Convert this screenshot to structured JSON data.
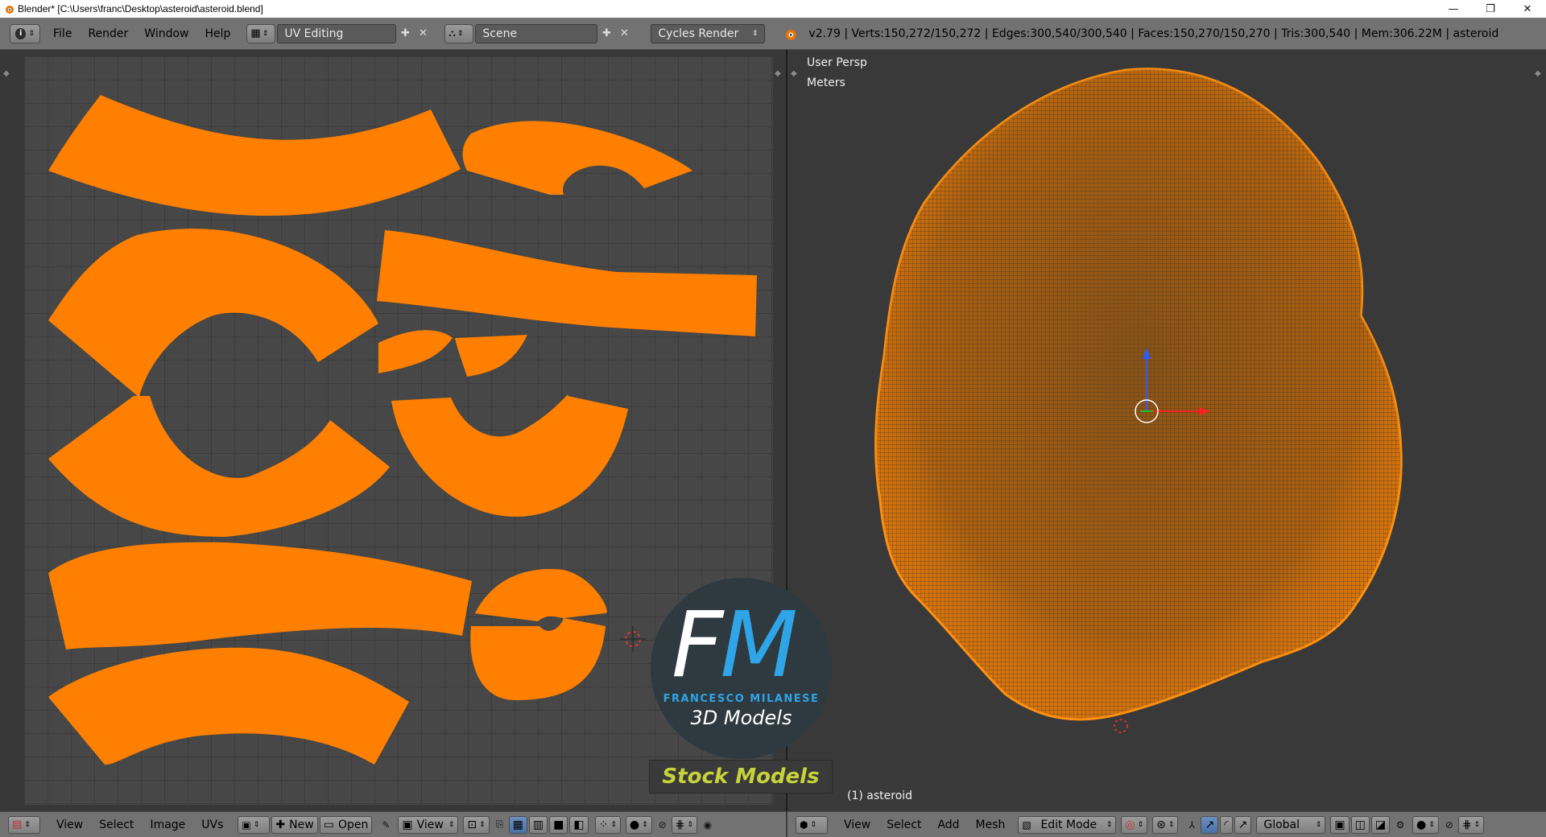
{
  "window": {
    "title": "Blender* [C:\\Users\\franc\\Desktop\\asteroid\\asteroid.blend]",
    "min": "—",
    "max": "❐",
    "close": "✕"
  },
  "infobar": {
    "menus": [
      "File",
      "Render",
      "Window",
      "Help"
    ],
    "screen_layout": "UV Editing",
    "scene": "Scene",
    "render_engine": "Cycles Render",
    "stats": "v2.79 | Verts:150,272/150,272 | Edges:300,540/300,540 | Faces:150,270/150,270 | Tris:300,540 | Mem:306.22M | asteroid"
  },
  "viewport": {
    "perspective": "User Persp",
    "units": "Meters",
    "object_label": "(1) asteroid"
  },
  "uv_footer": {
    "menus": [
      "View",
      "Select",
      "Image",
      "UVs"
    ],
    "new_label": "New",
    "open_label": "Open",
    "view_label": "View"
  },
  "view3d_footer": {
    "menus": [
      "View",
      "Select",
      "Add",
      "Mesh"
    ],
    "mode": "Edit Mode",
    "orientation": "Global"
  },
  "watermark": {
    "letter_f": "F",
    "letter_m": "M",
    "name": "FRANCESCO MILANESE",
    "tagline": "3D Models",
    "banner": "Stock Models"
  },
  "colors": {
    "uv_island": "#ff8000",
    "mesh_wire": "#f08a10",
    "header": "#727272",
    "grid_bg": "#474747"
  }
}
